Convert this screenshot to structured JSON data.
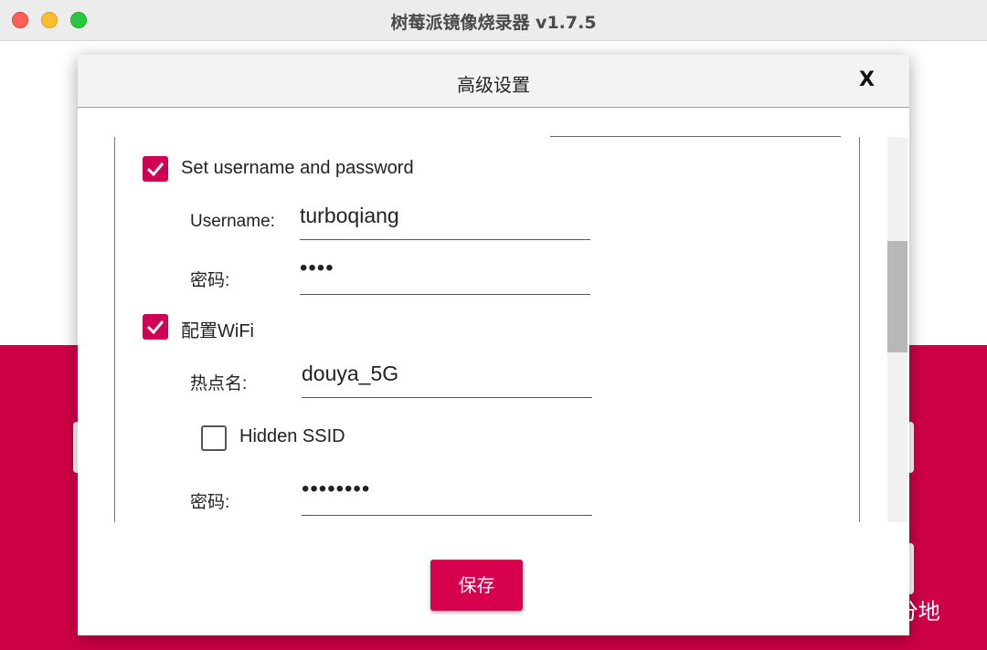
{
  "window": {
    "title": "树莓派镜像烧录器 v1.7.5"
  },
  "dialog": {
    "title": "高级设置",
    "close_label": "X",
    "set_credentials": {
      "checked": true,
      "label": "Set username and password"
    },
    "username": {
      "label": "Username:",
      "value": "turboqiang"
    },
    "password": {
      "label": "密码:",
      "value": "••••"
    },
    "configure_wifi": {
      "checked": true,
      "label": "配置WiFi"
    },
    "ssid": {
      "label": "热点名:",
      "value": "douya_5G"
    },
    "hidden_ssid": {
      "checked": false,
      "label": "Hidden SSID"
    },
    "wifi_password": {
      "label": "密码:",
      "value": "••••••••"
    },
    "save_label": "保存"
  },
  "watermark": {
    "text": "Java三分地",
    "icon": "wechat-icon"
  },
  "colors": {
    "accent": "#d6004f",
    "background_red": "#cf0046"
  }
}
